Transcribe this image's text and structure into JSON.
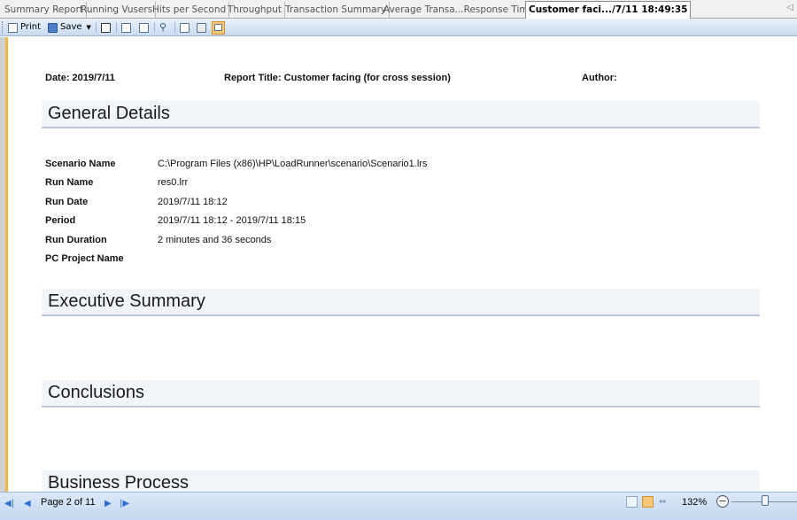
{
  "tabs": [
    {
      "label": "Summary Report",
      "active": false
    },
    {
      "label": "Running Vusers",
      "active": false
    },
    {
      "label": "Hits per Second",
      "active": false
    },
    {
      "label": "Throughput",
      "active": false
    },
    {
      "label": "Transaction Summary",
      "active": false
    },
    {
      "label": "Average Transa...Response Time",
      "active": false
    },
    {
      "label": "Customer faci.../7/11  18:49:35",
      "active": true
    }
  ],
  "tab_scroll_icon": "scroll-left-icon",
  "toolbar": {
    "print_label": "Print",
    "save_label": "Save",
    "icons": [
      "printer-icon",
      "save-icon",
      "dropdown-arrow-icon",
      "single-page-icon",
      "two-page-icon",
      "multi-page-icon",
      "find-icon",
      "thumbnails-icon",
      "page-setup-icon",
      "export-icon"
    ]
  },
  "report": {
    "date": "Date: 2019/7/11",
    "title": "Report Title: Customer facing (for cross session)",
    "author": "Author:",
    "sections": {
      "general": "General Details",
      "executive": "Executive Summary",
      "conclusions": "Conclusions",
      "business": "Business Process"
    },
    "details": [
      {
        "label": "Scenario Name",
        "value": "C:\\Program Files (x86)\\HP\\LoadRunner\\scenario\\Scenario1.lrs"
      },
      {
        "label": "Run Name",
        "value": "res0.lrr"
      },
      {
        "label": "Run Date",
        "value": "2019/7/11 18:12"
      },
      {
        "label": "Period",
        "value": "2019/7/11 18:12 - 2019/7/11 18:15"
      },
      {
        "label": "Run Duration",
        "value": "2 minutes and 36 seconds"
      },
      {
        "label": "PC Project Name",
        "value": ""
      }
    ]
  },
  "statusbar": {
    "page_label": "Page 2 of 11",
    "zoom_label": "132%",
    "zoom_minus": "−"
  },
  "colors": {
    "accent": "#f2b640",
    "toolbar_bg": "#c9dbf2",
    "section_bg": "#f1f4f8"
  }
}
